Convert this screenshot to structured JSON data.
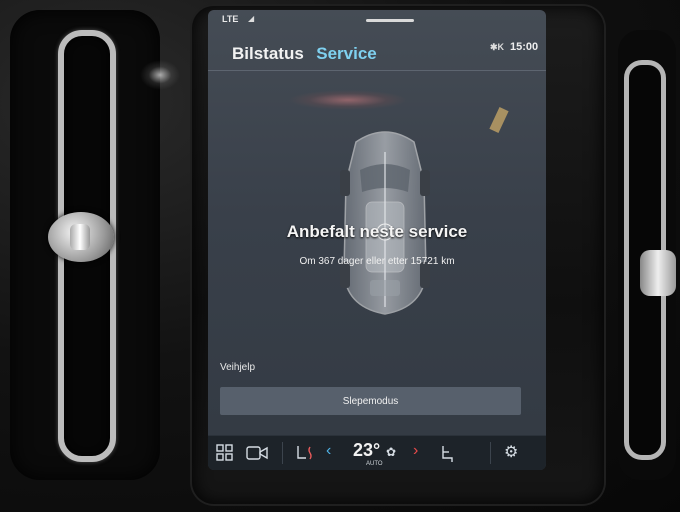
{
  "statusbar": {
    "network": "LTE",
    "time": "15:00",
    "bt_label": "✱K"
  },
  "tabs": [
    {
      "label": "Bilstatus"
    },
    {
      "label": "Service"
    }
  ],
  "service": {
    "headline": "Anbefalt neste service",
    "subline": "Om 367 dager eller etter 15721 km"
  },
  "assistance": {
    "label": "Veihjelp",
    "tow_button": "Slepemodus"
  },
  "climate": {
    "temperature": "23°",
    "mode": "AUTO",
    "left_arrow": "‹",
    "right_arrow": "›"
  }
}
